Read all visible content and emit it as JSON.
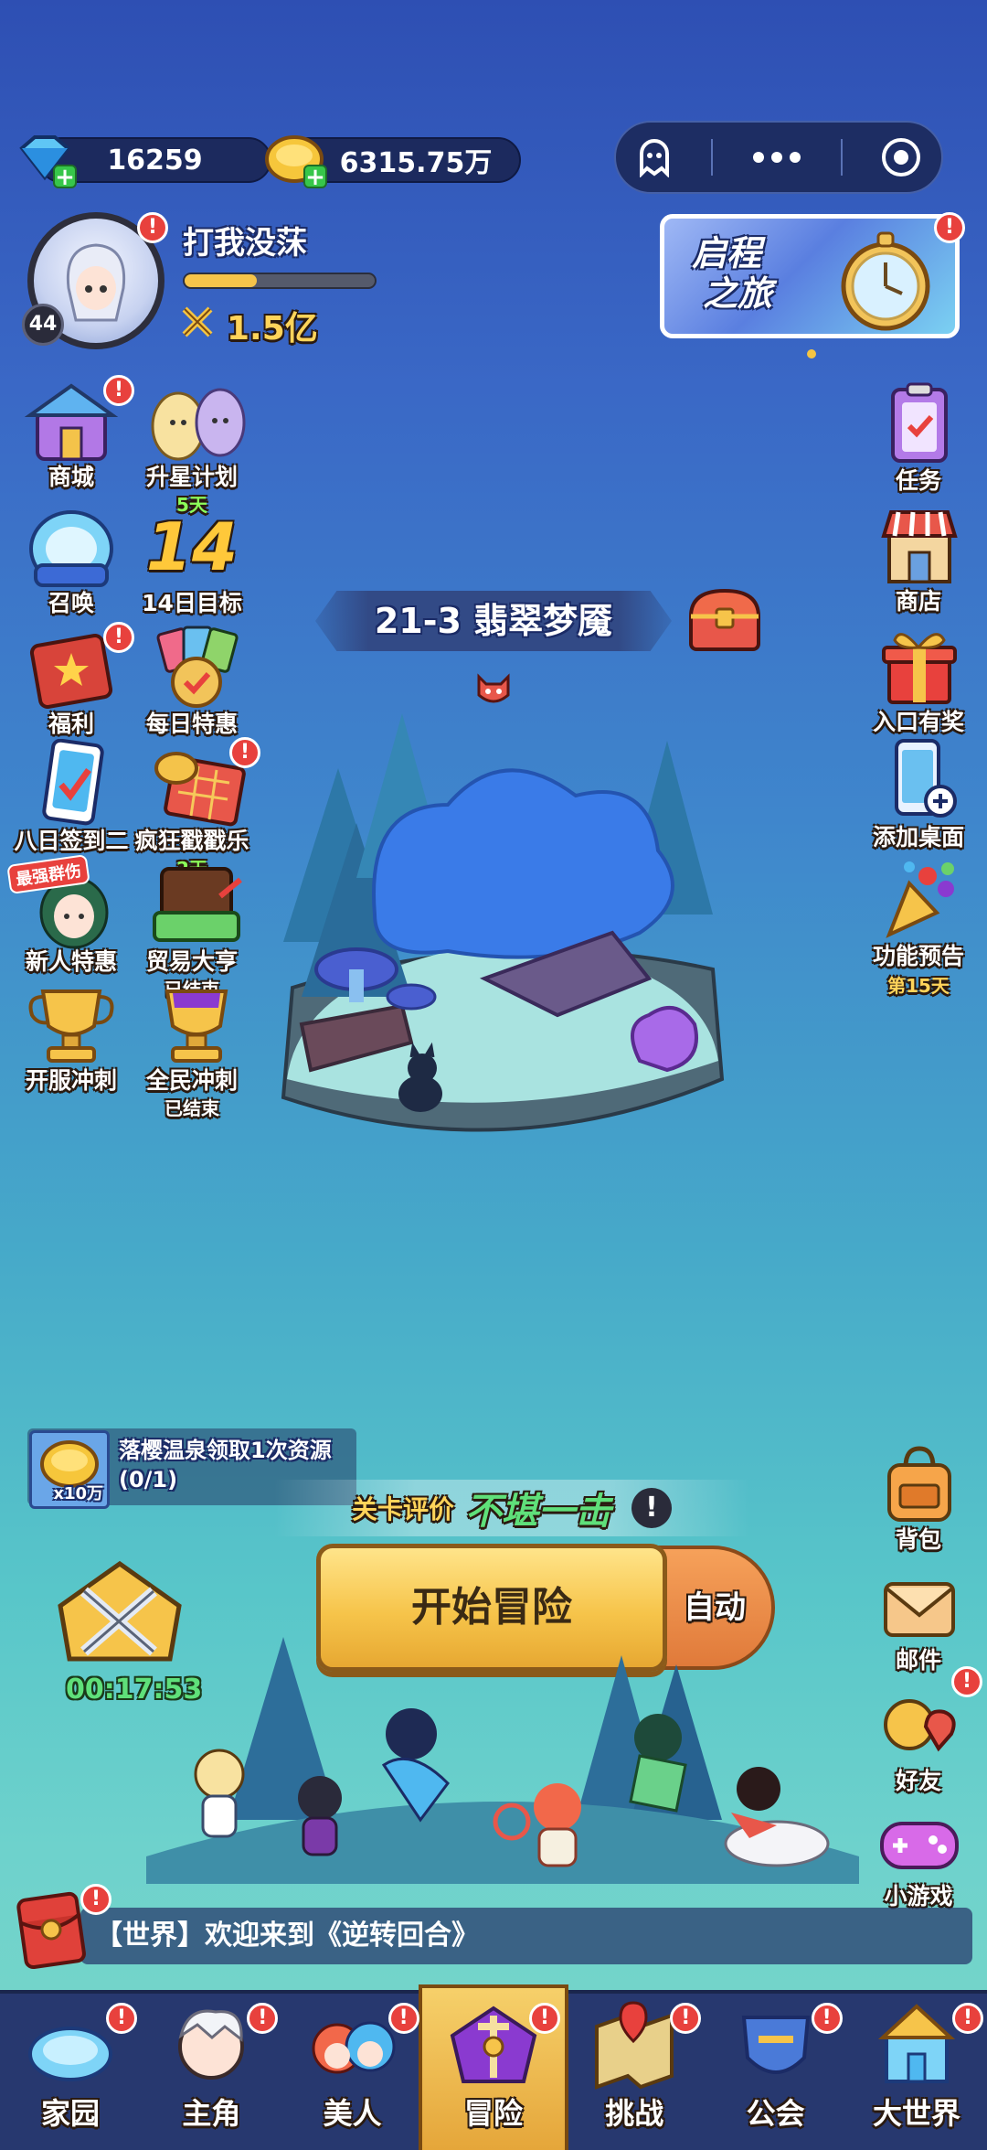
{
  "currency": {
    "gems": "16259",
    "gold": "6315.75万"
  },
  "player": {
    "name": "打我没莯",
    "level": "44",
    "power": "1.5亿",
    "exp_fraction": 0.38
  },
  "event_banner": {
    "text": "启程之旅",
    "line1": "启程",
    "line2": "之旅"
  },
  "left_menu": [
    {
      "label": "商城",
      "badge": "!"
    },
    {
      "label": "升星计划",
      "sub": "5天"
    },
    {
      "label": "召唤"
    },
    {
      "label": "14日目标",
      "num": "14"
    },
    {
      "label": "福利",
      "badge": "!"
    },
    {
      "label": "每日特惠"
    },
    {
      "label": "八日签到二"
    },
    {
      "label": "疯狂戳戳乐",
      "sub": "2天",
      "badge": "!"
    },
    {
      "label": "新人特惠",
      "tag": "最强群伤"
    },
    {
      "label": "贸易大亨",
      "sub": "已结束"
    },
    {
      "label": "开服冲刺"
    },
    {
      "label": "全民冲刺",
      "sub": "已结束"
    }
  ],
  "right_menu": [
    {
      "label": "任务"
    },
    {
      "label": "商店"
    },
    {
      "label": "入口有奖"
    },
    {
      "label": "添加桌面"
    },
    {
      "label": "功能预告",
      "sub": "第15天"
    }
  ],
  "stage": {
    "title": "21-3 翡翠梦魇"
  },
  "quest": {
    "text": "落樱温泉领取1次资源(0/1)",
    "reward": "x10万"
  },
  "rating": {
    "label": "关卡评价",
    "value": "不堪一击"
  },
  "battle": {
    "start_label": "开始冒险",
    "auto_label": "自动",
    "timer": "00:17:53"
  },
  "right_bottom_menu": [
    {
      "label": "背包"
    },
    {
      "label": "邮件"
    },
    {
      "label": "好友",
      "badge": "!"
    },
    {
      "label": "小游戏"
    }
  ],
  "chat": {
    "channel": "【世界】",
    "message": "欢迎来到《逆转回合》"
  },
  "tabs": [
    {
      "label": "家园"
    },
    {
      "label": "主角"
    },
    {
      "label": "美人"
    },
    {
      "label": "冒险",
      "active": true
    },
    {
      "label": "挑战"
    },
    {
      "label": "公会"
    },
    {
      "label": "大世界"
    }
  ],
  "colors": {
    "accent_gold": "#f5c34a",
    "badge_red": "#e8413d",
    "tab_bar": "#27386f",
    "good_green": "#5fe07a"
  }
}
